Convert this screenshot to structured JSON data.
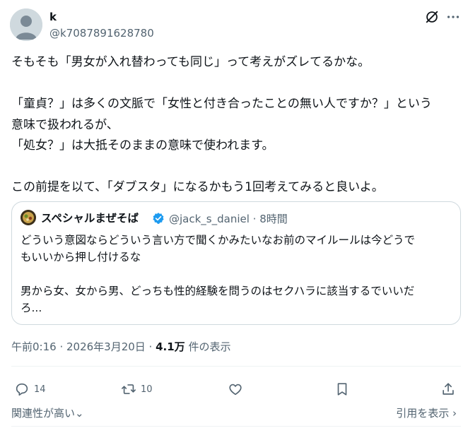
{
  "author": {
    "name": "k",
    "handle": "@k7087891628780"
  },
  "icons": {
    "grok": "grok-icon",
    "more": "more-icon",
    "verified": "verified-badge-icon",
    "reply": "reply-icon",
    "retweet": "retweet-icon",
    "like": "like-icon",
    "bookmark": "bookmark-icon",
    "share": "share-icon"
  },
  "tweet": {
    "lines": [
      "そもそも「男女が入れ替わっても同じ」って考えがズレてるかな。",
      "",
      "「童貞？」は多くの文脈で「女性と付き合ったことの無い人ですか？」という",
      "意味で扱われるが、",
      "「処女？」は大抵そのままの意味で使われます。",
      "",
      "この前提を以て、「ダブスタ」になるかもう1回考えてみると良いよ。"
    ]
  },
  "quote": {
    "name": "スペシャルまぜそば",
    "handle_time": "@jack_s_daniel · 8時間",
    "lines": [
      "どういう意図ならどういう言い方で聞くかみたいなお前のマイルールは今どうで",
      "もいいから押し付けるな",
      "",
      "男から女、女から男、どっちも性的経験を問うのはセクハラに該当するでいいだ",
      "ろ..."
    ]
  },
  "meta": {
    "timestamp": "午前0:16 · 2026年3月20日 · ",
    "views_count": "4.1万",
    "views_label": " 件の表示"
  },
  "actions": {
    "replies": "14",
    "retweets": "10"
  },
  "footer": {
    "sort_label": "関連性が高い",
    "quotes_label": "引用を表示",
    "sort_chevron": "⌄",
    "quotes_chevron": "›"
  },
  "colors": {
    "text": "#0f1419",
    "secondary": "#536471",
    "border": "#cfd9de",
    "verified": "#1d9bf0"
  }
}
